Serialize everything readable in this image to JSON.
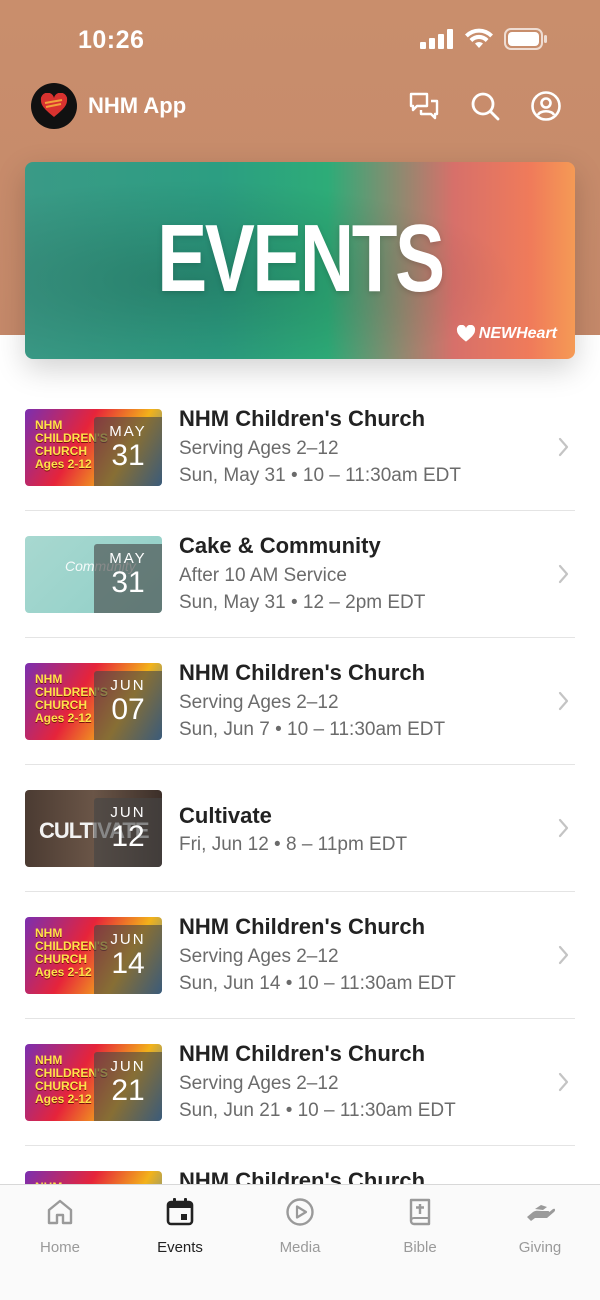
{
  "status_bar": {
    "time": "10:26"
  },
  "header": {
    "app_title": "NHM App"
  },
  "banner": {
    "title": "EVENTS",
    "brand": "NEWHeart"
  },
  "events": [
    {
      "title": "NHM Children's Church",
      "subtitle": "Serving Ages 2–12",
      "when": "Sun, May 31 • 10 – 11:30am EDT",
      "month": "MAY",
      "day": "31",
      "thumb": "kids",
      "thumb_text": "NHM CHILDREN'S CHURCH Ages 2-12"
    },
    {
      "title": "Cake & Community",
      "subtitle": "After 10 AM Service",
      "when": "Sun, May 31 • 12 – 2pm EDT",
      "month": "MAY",
      "day": "31",
      "thumb": "cake",
      "thumb_text": "Community"
    },
    {
      "title": "NHM Children's Church",
      "subtitle": "Serving Ages 2–12",
      "when": "Sun, Jun 7 • 10 – 11:30am EDT",
      "month": "JUN",
      "day": "07",
      "thumb": "kids",
      "thumb_text": "NHM CHILDREN'S CHURCH Ages 2-12"
    },
    {
      "title": "Cultivate",
      "subtitle": "",
      "when": "Fri, Jun 12 • 8 – 11pm EDT",
      "month": "JUN",
      "day": "12",
      "thumb": "cult",
      "thumb_text": "CULTIVATE"
    },
    {
      "title": "NHM Children's Church",
      "subtitle": "Serving Ages 2–12",
      "when": "Sun, Jun 14 • 10 – 11:30am EDT",
      "month": "JUN",
      "day": "14",
      "thumb": "kids",
      "thumb_text": "NHM CHILDREN'S CHURCH Ages 2-12"
    },
    {
      "title": "NHM Children's Church",
      "subtitle": "Serving Ages 2–12",
      "when": "Sun, Jun 21 • 10 – 11:30am EDT",
      "month": "JUN",
      "day": "21",
      "thumb": "kids",
      "thumb_text": "NHM CHILDREN'S CHURCH Ages 2-12"
    },
    {
      "title": "NHM Children's Church",
      "subtitle": "",
      "when": "",
      "month": "",
      "day": "",
      "thumb": "kids",
      "thumb_text": "NHM"
    }
  ],
  "tabs": [
    {
      "label": "Home",
      "icon": "home-icon",
      "active": false
    },
    {
      "label": "Events",
      "icon": "calendar-icon",
      "active": true
    },
    {
      "label": "Media",
      "icon": "play-icon",
      "active": false
    },
    {
      "label": "Bible",
      "icon": "bible-icon",
      "active": false
    },
    {
      "label": "Giving",
      "icon": "giving-icon",
      "active": false
    }
  ],
  "colors": {
    "header_bg": "#c98e6c",
    "text_primary": "#222222",
    "text_secondary": "#6b6b6b",
    "tab_inactive": "#9a9a9a"
  }
}
